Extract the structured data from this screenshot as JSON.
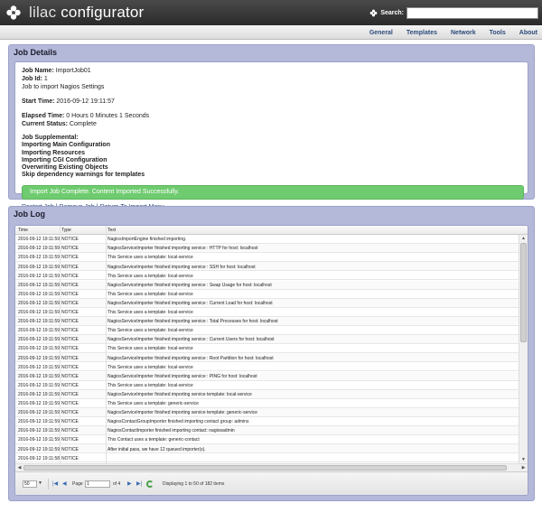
{
  "header": {
    "app_name_1": "lilac",
    "app_name_2": "configurator",
    "search_label": "Search:",
    "search_value": ""
  },
  "nav": {
    "items": [
      "General",
      "Templates",
      "Network",
      "Tools",
      "About"
    ]
  },
  "job_details": {
    "title": "Job Details",
    "job_name_label": "Job Name:",
    "job_name": "ImportJob01",
    "job_id_label": "Job Id:",
    "job_id": "1",
    "description": "Job to import Nagios Settings",
    "start_time_label": "Start Time:",
    "start_time": "2016-09-12 19:11:57",
    "elapsed_label": "Elapsed Time:",
    "elapsed": "0 Hours 0 Minutes 1 Seconds",
    "status_label": "Current Status:",
    "status": "Complete",
    "supplemental": [
      "Job Supplemental:",
      "Importing Main Configuration",
      "Importing Resources",
      "Importing CGI Configuration",
      "Overwriting Existing Objects",
      "Skip dependency warnings for templates"
    ],
    "success_message": "Import Job Complete. Content Imported Successfully.",
    "links": [
      "Restart Job",
      "Remove Job",
      "Return To Import Menu"
    ],
    "link_sep": "|"
  },
  "job_log": {
    "title": "Job Log",
    "columns": [
      "Time",
      "Type",
      "Text"
    ],
    "rows": [
      {
        "time": "2016-09-12 19:11:59",
        "type": "NOTICE",
        "text": "NagiosImportEngine finished importing."
      },
      {
        "time": "2016-09-12 19:11:59",
        "type": "NOTICE",
        "text": "NagiosServiceImporter finished importing service : HTTP for host: localhost"
      },
      {
        "time": "2016-09-12 19:11:59",
        "type": "NOTICE",
        "text": "This Service uses a template: local-service"
      },
      {
        "time": "2016-09-12 19:11:59",
        "type": "NOTICE",
        "text": "NagiosServiceImporter finished importing service : SSH for host: localhost"
      },
      {
        "time": "2016-09-12 19:11:59",
        "type": "NOTICE",
        "text": "This Service uses a template: local-service"
      },
      {
        "time": "2016-09-12 19:11:59",
        "type": "NOTICE",
        "text": "NagiosServiceImporter finished importing service : Swap Usage for host: localhost"
      },
      {
        "time": "2016-09-12 19:11:59",
        "type": "NOTICE",
        "text": "This Service uses a template: local-service"
      },
      {
        "time": "2016-09-12 19:11:59",
        "type": "NOTICE",
        "text": "NagiosServiceImporter finished importing service : Current Load for host: localhost"
      },
      {
        "time": "2016-09-12 19:11:59",
        "type": "NOTICE",
        "text": "This Service uses a template: local-service"
      },
      {
        "time": "2016-09-12 19:11:59",
        "type": "NOTICE",
        "text": "NagiosServiceImporter finished importing service : Total Processes for host: localhost"
      },
      {
        "time": "2016-09-12 19:11:59",
        "type": "NOTICE",
        "text": "This Service uses a template: local-service"
      },
      {
        "time": "2016-09-12 19:11:59",
        "type": "NOTICE",
        "text": "NagiosServiceImporter finished importing service : Current Users for host: localhost"
      },
      {
        "time": "2016-09-12 19:11:59",
        "type": "NOTICE",
        "text": "This Service uses a template: local-service"
      },
      {
        "time": "2016-09-12 19:11:59",
        "type": "NOTICE",
        "text": "NagiosServiceImporter finished importing service : Root Partition for host: localhost"
      },
      {
        "time": "2016-09-12 19:11:59",
        "type": "NOTICE",
        "text": "This Service uses a template: local-service"
      },
      {
        "time": "2016-09-12 19:11:59",
        "type": "NOTICE",
        "text": "NagiosServiceImporter finished importing service : PING for host: localhost"
      },
      {
        "time": "2016-09-12 19:11:59",
        "type": "NOTICE",
        "text": "This Service uses a template: local-service"
      },
      {
        "time": "2016-09-12 19:11:59",
        "type": "NOTICE",
        "text": "NagiosServiceImporter finished importing service template: local-service"
      },
      {
        "time": "2016-09-12 19:11:59",
        "type": "NOTICE",
        "text": "This Service uses a template: generic-service"
      },
      {
        "time": "2016-09-12 19:11:59",
        "type": "NOTICE",
        "text": "NagiosServiceImporter finished importing service template: generic-service"
      },
      {
        "time": "2016-09-12 19:11:59",
        "type": "NOTICE",
        "text": "NagiosContactGroupImporter finished importing contact group: admins"
      },
      {
        "time": "2016-09-12 19:11:59",
        "type": "NOTICE",
        "text": "NagiosContactImporter finished importing contact: nagiosadmin"
      },
      {
        "time": "2016-09-12 19:11:59",
        "type": "NOTICE",
        "text": "This Contact uses a template: generic-contact"
      },
      {
        "time": "2016-09-12 19:11:59",
        "type": "NOTICE",
        "text": "After initial pass, we have 12 queued importer(s)."
      },
      {
        "time": "2016-09-12 19:11:58",
        "type": "NOTICE",
        "text": ""
      }
    ],
    "pager": {
      "page_size": "50",
      "page_label": "Page",
      "page_value": "1",
      "of_label": "of 4",
      "displaying": "Displaying 1 to 50 of 182 items"
    }
  },
  "colors": {
    "header_bg": "#333333",
    "panel_bg": "#b4b8d9",
    "success_bg": "#6fcb6f",
    "link": "#2b4a7a"
  }
}
